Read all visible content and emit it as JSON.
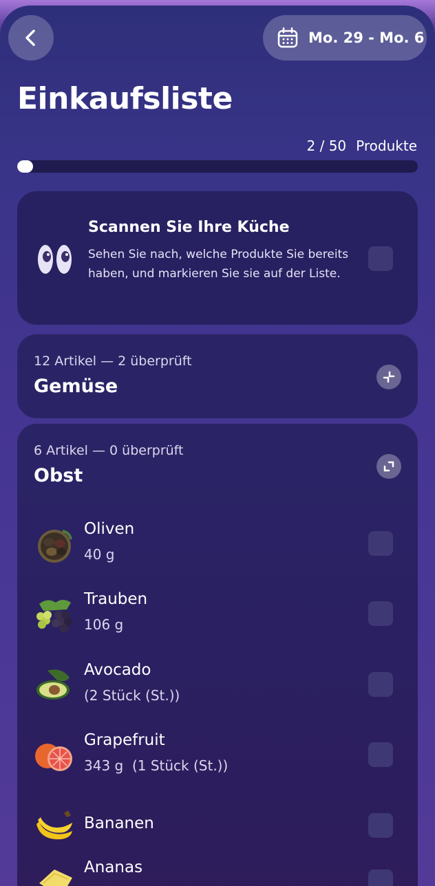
{
  "header": {
    "date_range": "Mo. 29 - Mo. 6"
  },
  "title": "Einkaufsliste",
  "progress": {
    "count": "2 / 50",
    "unit": "Produkte",
    "fraction": 0.04
  },
  "scan_card": {
    "title": "Scannen Sie Ihre Küche",
    "description": "Sehen Sie nach, welche Produkte Sie bereits haben, und markieren Sie sie auf der Liste."
  },
  "categories": [
    {
      "count_text": "12 Artikel — 2 überprüft",
      "name": "Gemüse",
      "collapsed": true
    },
    {
      "count_text": "6 Artikel — 0 überprüft",
      "name": "Obst",
      "collapsed": false,
      "items": [
        {
          "name": "Oliven",
          "qty": "40 g",
          "icon": "olives-icon"
        },
        {
          "name": "Trauben",
          "qty": "106 g",
          "icon": "grapes-icon"
        },
        {
          "name": "Avocado",
          "qty": "(2 Stück (St.))",
          "icon": "avocado-icon"
        },
        {
          "name": "Grapefruit",
          "qty": "343 g  (1 Stück (St.))",
          "icon": "grapefruit-icon"
        },
        {
          "name": "Bananen",
          "qty": "",
          "icon": "banana-icon"
        },
        {
          "name": "Ananas",
          "qty": "",
          "icon": "pineapple-icon"
        }
      ]
    }
  ]
}
